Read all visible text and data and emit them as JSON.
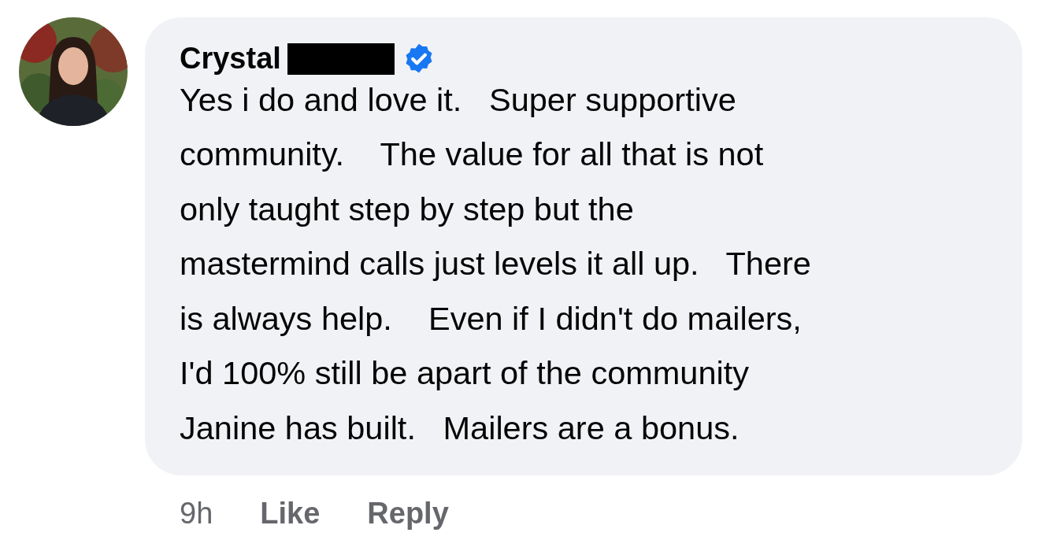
{
  "comment": {
    "author": "Crystal",
    "redacted": true,
    "verified": true,
    "lines": [
      "Yes i do and love it.   Super supportive",
      "community.    The value for all that is not",
      "only taught step by step but the",
      "mastermind calls just levels it all up.   There",
      "is always help.    Even if I didn't do mailers,",
      "I'd 100% still be apart of the community",
      "Janine has built.   Mailers are a bonus."
    ]
  },
  "footer": {
    "time": "9h",
    "actions": [
      "Like",
      "Reply"
    ]
  }
}
